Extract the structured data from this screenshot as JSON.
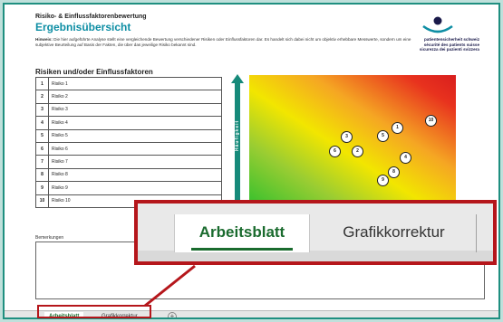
{
  "header": {
    "title": "Risiko- & Einflussfaktorenbewertung",
    "subtitle": "Ergebnisübersicht",
    "intro_label": "Hinweis:",
    "intro_text": "Die hier aufgeführte Analyse stellt eine vergleichende Bewertung verschiedener Risiken oder Einflussfaktoren dar. Es handelt sich dabei nicht um objektiv erhebbare Messwerte, sondern um eine subjektive Beurteilung auf Basis der Fakten, die über das jeweilige Risiko bekannt sind."
  },
  "logo": {
    "line1": "patientensicherheit schweiz",
    "line2": "sécurité des patients suisse",
    "line3": "sicurezza dei pazienti svizzera",
    "color_main": "#1a1a4a",
    "color_accent": "#0e8ea4"
  },
  "risks": {
    "heading": "Risiken und/oder Einflussfaktoren",
    "rows": [
      {
        "num": "1",
        "label": "Risiko 1"
      },
      {
        "num": "2",
        "label": "Risiko 2"
      },
      {
        "num": "3",
        "label": "Risiko 3"
      },
      {
        "num": "4",
        "label": "Risiko 4"
      },
      {
        "num": "5",
        "label": "Risiko 5"
      },
      {
        "num": "6",
        "label": "Risiko 6"
      },
      {
        "num": "7",
        "label": "Risiko 7"
      },
      {
        "num": "8",
        "label": "Risiko 8"
      },
      {
        "num": "9",
        "label": "Risiko 9"
      },
      {
        "num": "10",
        "label": "Risiko 10"
      }
    ]
  },
  "matrix": {
    "y_axis_label": "Häufigkeit",
    "markers": [
      "1",
      "2",
      "3",
      "4",
      "5",
      "6",
      "8",
      "9",
      "10"
    ]
  },
  "remarks": {
    "label": "Bemerkungen"
  },
  "sheet_tabs": {
    "active": "Arbeitsblatt",
    "other": "Grafikkorrektur",
    "add_symbol": "+"
  },
  "zoom": {
    "active": "Arbeitsblatt",
    "other": "Grafikkorrektur",
    "highlight_color": "#b5161b",
    "tab_accent_color": "#1a6b2e"
  },
  "colors": {
    "frame": "#1f8f80",
    "background": "#bfe0db"
  }
}
